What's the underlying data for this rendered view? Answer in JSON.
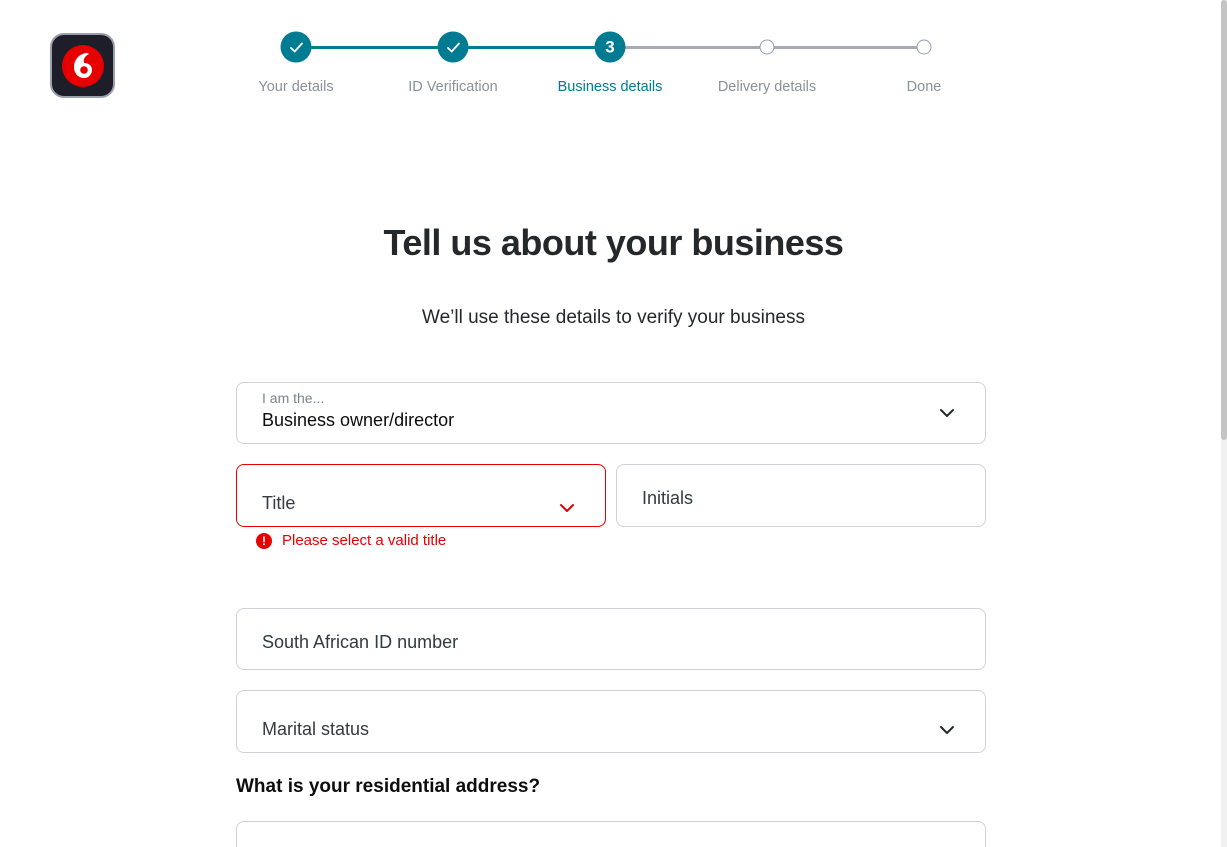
{
  "brand": {
    "logo_icon": "vodafone-speechmark-icon",
    "accent": "#007c92",
    "brand_red": "#e60000"
  },
  "stepper": {
    "steps": [
      {
        "label": "Your details",
        "state": "done"
      },
      {
        "label": "ID Verification",
        "state": "done"
      },
      {
        "label": "Business details",
        "state": "current",
        "number": "3"
      },
      {
        "label": "Delivery details",
        "state": "todo"
      },
      {
        "label": "Done",
        "state": "todo"
      }
    ]
  },
  "page": {
    "heading": "Tell us about your business",
    "subheading": "We’ll use these details to verify your business"
  },
  "form": {
    "role": {
      "label": "I am the...",
      "value": "Business owner/director"
    },
    "title": {
      "placeholder": "Title",
      "error": "Please select a valid title"
    },
    "initials": {
      "placeholder": "Initials"
    },
    "id_number": {
      "placeholder": "South African ID number"
    },
    "marital_status": {
      "placeholder": "Marital status"
    },
    "address_section_title": "What is your residential address?"
  }
}
